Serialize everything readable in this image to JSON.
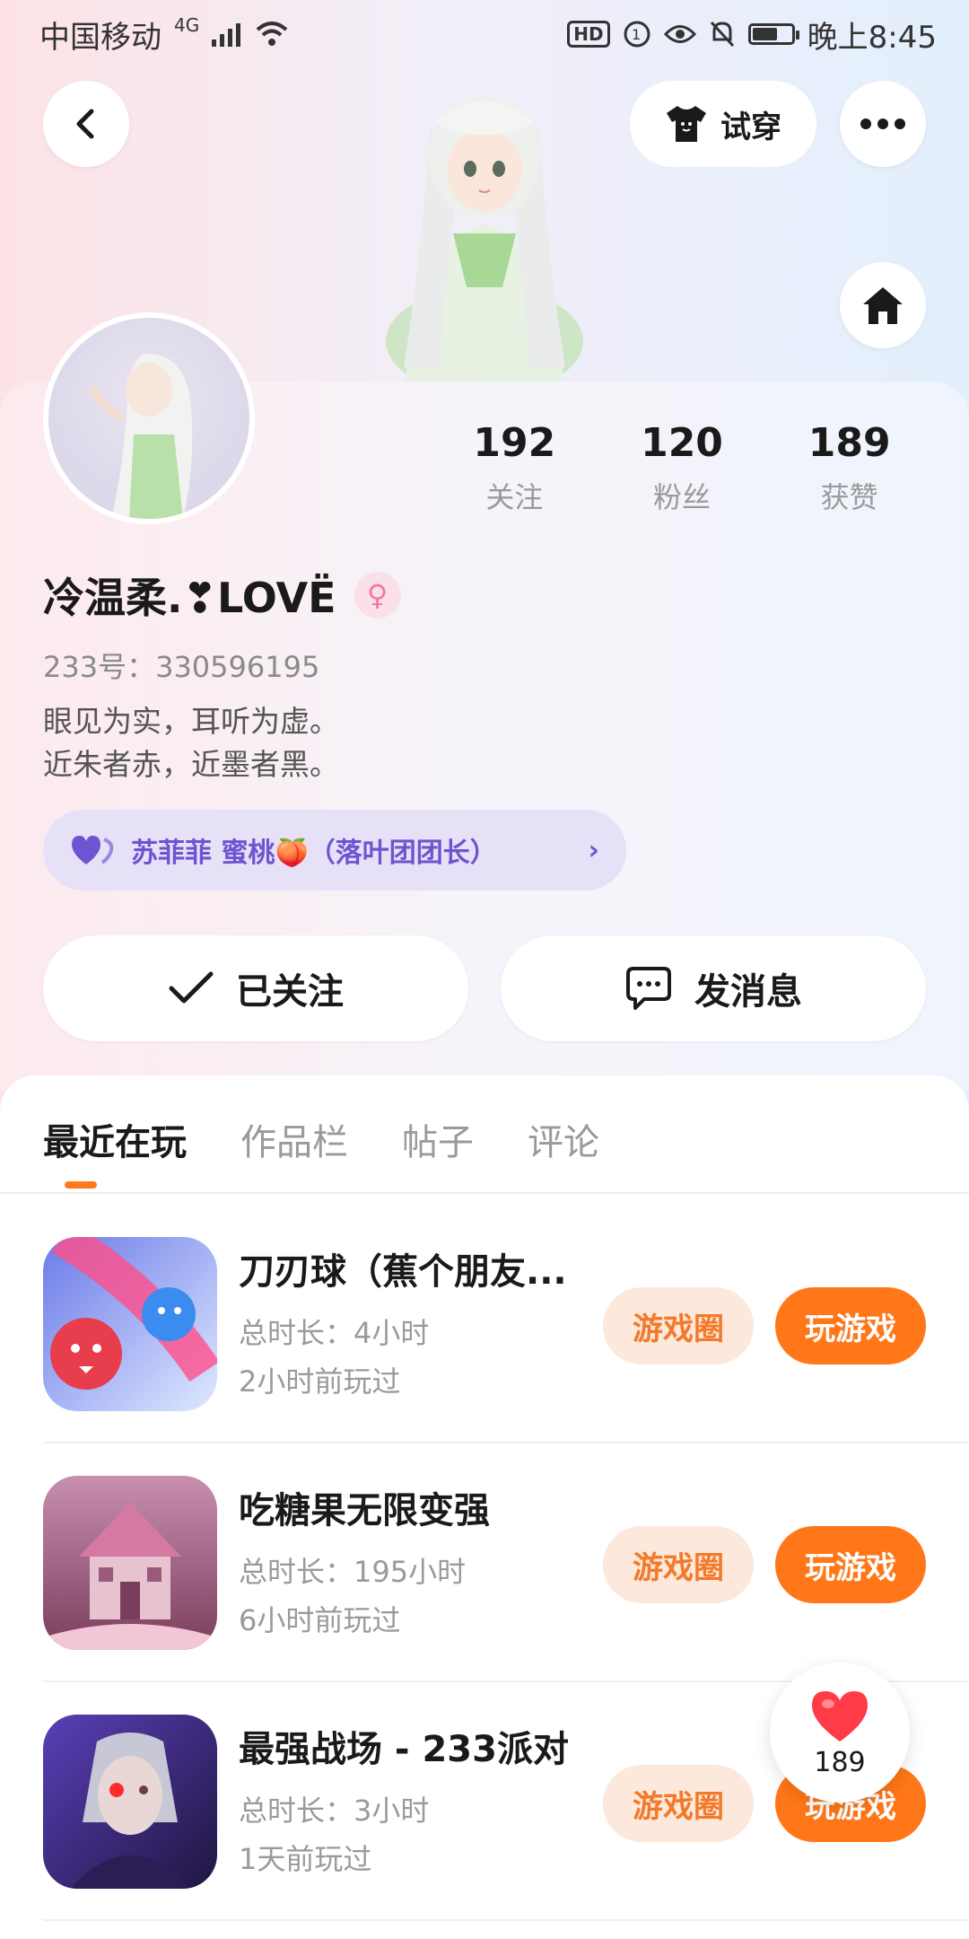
{
  "status_bar": {
    "carrier": "中国移动",
    "network": "4G",
    "time": "晚上8:45"
  },
  "header": {
    "try_on_label": "试穿"
  },
  "profile": {
    "stats": [
      {
        "value": "192",
        "label": "关注"
      },
      {
        "value": "120",
        "label": "粉丝"
      },
      {
        "value": "189",
        "label": "获赞"
      }
    ],
    "nickname": "冷温柔.❣LOVË",
    "uid": "233号：330596195",
    "bio_lines": [
      "眼见为实，耳听为虚。",
      "近朱者赤，近墨者黑。"
    ],
    "group_pill": "苏菲菲  蜜桃🍑（落叶团团长）",
    "followed_label": "已关注",
    "message_label": "发消息"
  },
  "tabs": [
    "最近在玩",
    "作品栏",
    "帖子",
    "评论"
  ],
  "games": [
    {
      "title": "刀刃球（蕉个朋友...",
      "duration": "总时长：4小时",
      "last_played": "2小时前玩过",
      "circle_label": "游戏圈",
      "play_label": "玩游戏"
    },
    {
      "title": "吃糖果无限变强",
      "duration": "总时长：195小时",
      "last_played": "6小时前玩过",
      "circle_label": "游戏圈",
      "play_label": "玩游戏"
    },
    {
      "title": "最强战场 - 233派对",
      "duration": "总时长：3小时",
      "last_played": "1天前玩过",
      "circle_label": "游戏圈",
      "play_label": "玩游戏"
    }
  ],
  "like_float": {
    "count": "189"
  },
  "colors": {
    "accent_orange": "#ff7718",
    "pill_purple": "#6d55d1"
  }
}
